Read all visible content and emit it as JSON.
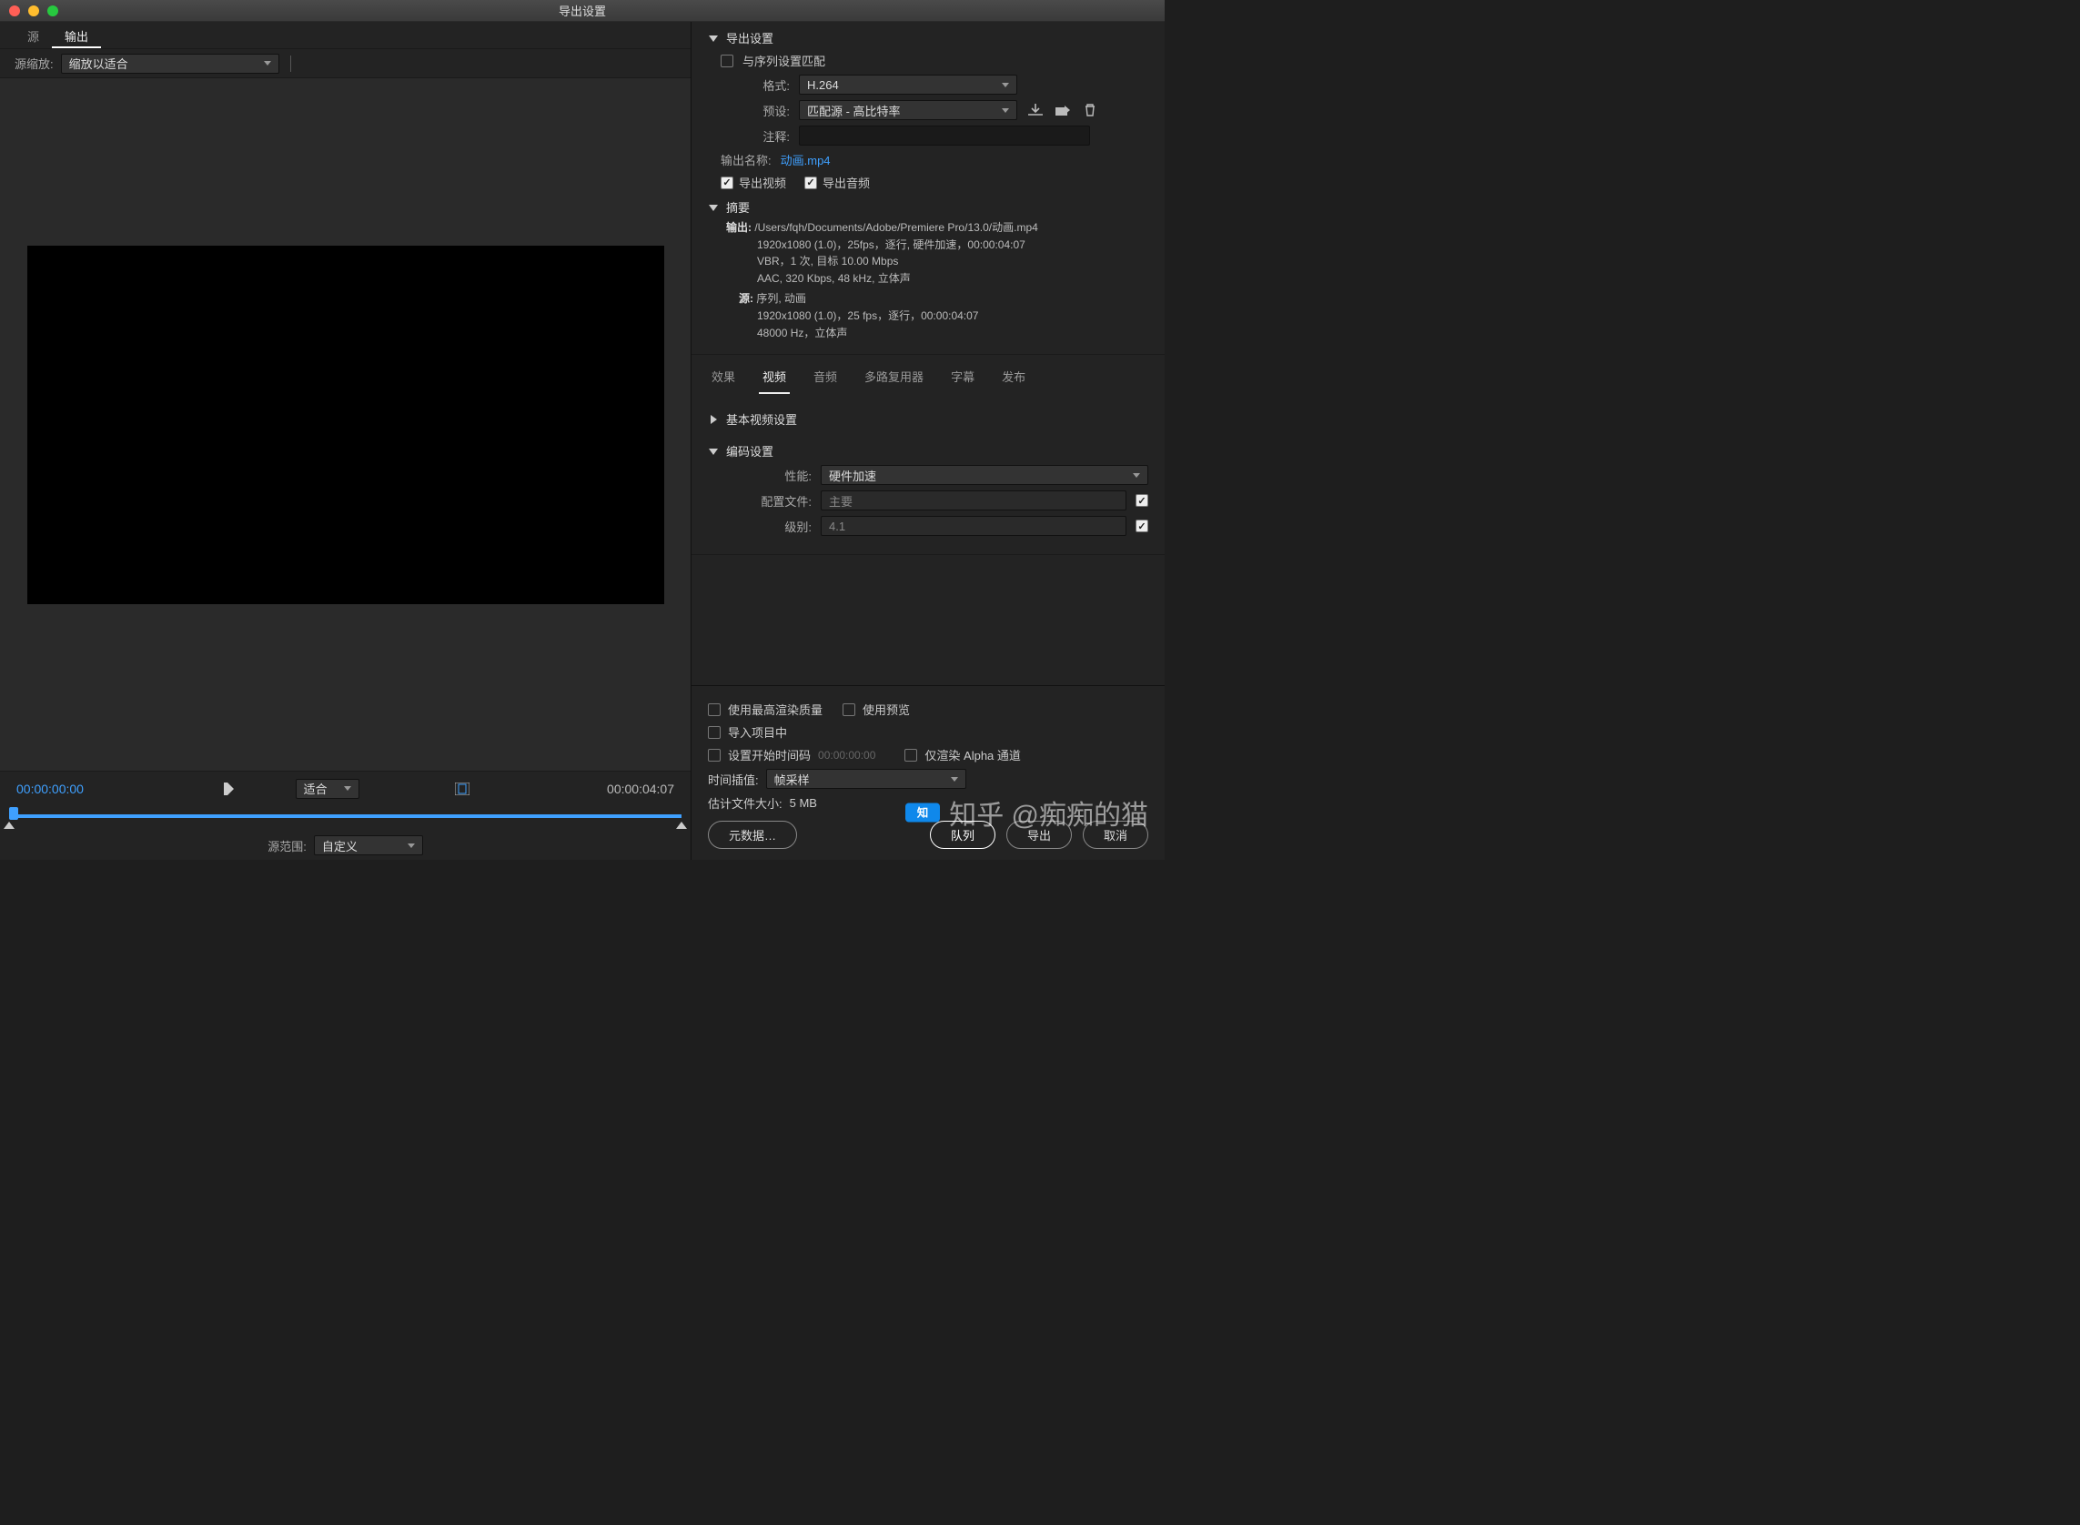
{
  "window_title": "导出设置",
  "left": {
    "tabs": [
      "源",
      "输出"
    ],
    "active_tab": 1,
    "scale_label": "源缩放:",
    "scale_value": "缩放以适合",
    "time_start": "00:00:00:00",
    "time_end": "00:00:04:07",
    "fit_label": "适合",
    "range_label": "源范围:",
    "range_value": "自定义"
  },
  "export": {
    "section_title": "导出设置",
    "match_seq": "与序列设置匹配",
    "format_label": "格式:",
    "format_value": "H.264",
    "preset_label": "预设:",
    "preset_value": "匹配源 - 高比特率",
    "comment_label": "注释:",
    "output_name_label": "输出名称:",
    "output_name": "动画.mp4",
    "export_video": "导出视频",
    "export_audio": "导出音频"
  },
  "summary": {
    "title": "摘要",
    "out_label": "输出:",
    "out_path": "/Users/fqh/Documents/Adobe/Premiere Pro/13.0/动画.mp4",
    "out_l1": "1920x1080 (1.0)，25fps，逐行, 硬件加速，00:00:04:07",
    "out_l2": "VBR，1 次, 目标 10.00 Mbps",
    "out_l3": "AAC, 320 Kbps, 48  kHz, 立体声",
    "src_label": "源:",
    "src0": "序列, 动画",
    "src_l1": "1920x1080 (1.0)，25 fps，逐行，00:00:04:07",
    "src_l2": "48000 Hz，立体声"
  },
  "vtabs": [
    "效果",
    "视频",
    "音频",
    "多路复用器",
    "字幕",
    "发布"
  ],
  "vtab_active": 1,
  "video": {
    "basic_title": "基本视频设置",
    "encode_title": "编码设置",
    "perf_label": "性能:",
    "perf_value": "硬件加速",
    "profile_label": "配置文件:",
    "profile_value": "主要",
    "level_label": "级别:",
    "level_value": "4.1"
  },
  "bottom": {
    "max_quality": "使用最高渲染质量",
    "use_preview": "使用预览",
    "import_project": "导入项目中",
    "set_start": "设置开始时间码",
    "start_tc": "00:00:00:00",
    "alpha_only": "仅渲染 Alpha 通道",
    "interp_label": "时间插值:",
    "interp_value": "帧采样",
    "est_label": "估计文件大小:",
    "est_value": "5 MB",
    "btn_meta": "元数据…",
    "btn_queue": "队列",
    "btn_export": "导出",
    "btn_cancel": "取消"
  },
  "watermark": "知乎 @痴痴的猫"
}
